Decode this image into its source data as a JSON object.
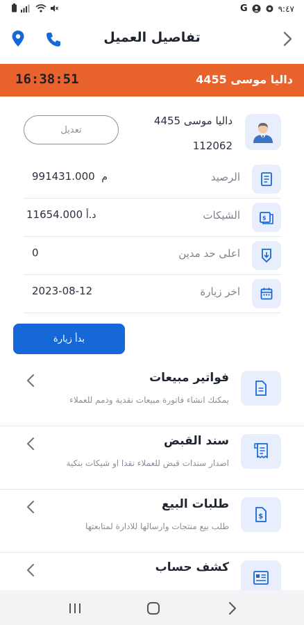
{
  "status_bar": {
    "time": "٩:٤٧",
    "google_letter": "G"
  },
  "header": {
    "title": "تفاصيل العميل"
  },
  "banner": {
    "customer": "داليا موسى 4455",
    "timer": "16:38:51"
  },
  "customer": {
    "name": "داليا موسى 4455",
    "code": "112062",
    "edit_label": "تعديل"
  },
  "info_rows": [
    {
      "label": "الرصيد",
      "value": "991431.000",
      "unit": "م"
    },
    {
      "label": "الشيكات",
      "value": "11654.000",
      "unit": "د.أ"
    },
    {
      "label": "اعلى حد مدين",
      "value": "0",
      "unit": ""
    },
    {
      "label": "اخر زيارة",
      "value": "2023-08-12",
      "unit": ""
    }
  ],
  "start_visit_label": "بدأ زيارة",
  "menu": [
    {
      "title": "فواتير مبيعات",
      "desc": "يمكنك انشاء فاتورة مبيعات نقدية وذمم للعملاء",
      "icon": "document-icon"
    },
    {
      "title": "سند القبض",
      "desc": "اصدار سندات قبض للعملاء نقدا او شيكات بنكية",
      "icon": "receipt-icon"
    },
    {
      "title": "طلبات البيع",
      "desc": "طلب بيع منتجات وارسالها للادارة لمتابعتها",
      "icon": "dollar-document-icon"
    },
    {
      "title": "كشف حساب",
      "desc": "",
      "icon": "statement-icon"
    }
  ],
  "colors": {
    "accent_orange": "#e8632c",
    "primary_blue": "#1668d9",
    "icon_bg": "#e8eefb"
  }
}
